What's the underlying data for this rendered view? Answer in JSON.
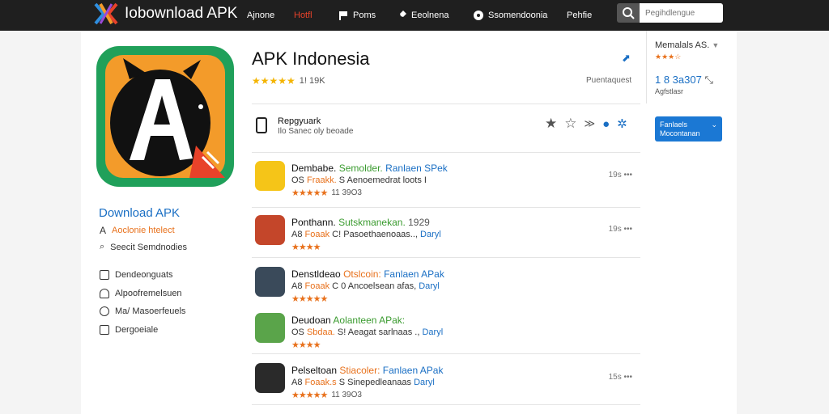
{
  "header": {
    "logo_text": "Iobownload APK",
    "nav": [
      {
        "label": "Ajnone",
        "icon": "none",
        "color": "#ffffff"
      },
      {
        "label": "Hotfl",
        "icon": "none",
        "color": "#e8422a"
      },
      {
        "label": "Poms",
        "icon": "flag-icon",
        "color": "#ffffff"
      },
      {
        "label": "Eeolnena",
        "icon": "puzzle-icon",
        "color": "#ffffff"
      },
      {
        "label": "Ssomendoonia",
        "icon": "chat-icon",
        "color": "#ffffff"
      },
      {
        "label": "Pehfie",
        "icon": "none",
        "color": "#ffffff"
      }
    ],
    "search_placeholder": "Pegihdlengue"
  },
  "app": {
    "title": "APK Indonesia",
    "rating_text": "1! 19K",
    "meta_right": "Puentaquest"
  },
  "developer": {
    "name": "Repgyuark",
    "sub": "Ilo Sanec oly beoade"
  },
  "left_panel": {
    "title": "Download APK",
    "row1": "Aoclonie htelect",
    "row2": "Seecit Semdnodies",
    "links": [
      "Dendeonguats",
      "Alpoofremelsuen",
      "Ma/ Masoerfeuels",
      "Dergoeiale"
    ]
  },
  "list": [
    {
      "name": "Dembabe.",
      "tag_green": "Semolder.",
      "tag_blue": "Ranlaen SPek",
      "prefix": "OS",
      "org_text": "Fraakk.",
      "desc": "S Aenoemedrat loots I",
      "blue_tail": "",
      "count": "11 39O3",
      "meta": "19s",
      "thumb": "#f5c518"
    },
    {
      "name": "Ponthann.",
      "tag_green": "Sutskmanekan.",
      "tag_blue": "1929",
      "prefix": "A8",
      "org_text": "Foaak",
      "desc": "C! Pasoethaenoaas..,",
      "blue_tail": "Daryl",
      "count": "",
      "meta": "19s",
      "thumb": "#c4462a"
    },
    {
      "name": "Denstldeao",
      "tag_green": "Otslcoin:",
      "tag_blue": "Fanlaen APak",
      "prefix": "A8",
      "org_text": "Foaak",
      "desc": "C 0 Ancoelsean afas,",
      "blue_tail": "Daryl",
      "count": "",
      "meta": "",
      "thumb": "#3a4a5a"
    },
    {
      "name": "Deudoan",
      "tag_green": "Aolanteen APak:",
      "tag_blue": "",
      "prefix": "OS",
      "org_text": "Sbdaa.",
      "desc": "S! Aeagat sarlnaas .,",
      "blue_tail": "Daryl",
      "count": "",
      "meta": "",
      "thumb": "#5aa44a"
    },
    {
      "name": "Pelseltoan",
      "tag_green": "Stiacoler:",
      "tag_blue": "Fanlaen APak",
      "prefix": "A8",
      "org_text": "Foaak.s",
      "desc": "S Sinepedleanaas",
      "blue_tail": "Daryl",
      "count": "11 39O3",
      "meta": "15s",
      "thumb": "#2a2a2a"
    }
  ],
  "sidebar": {
    "name": "Memalals AS.",
    "stars_text": "★★★☆",
    "number": "1 8 3a307",
    "sub": "Agfstlasr",
    "button_line1": "Fanlaels",
    "button_line2": "Mocontanan"
  },
  "colors": {
    "accent": "#1a6fc4",
    "topbar": "#1f1f1f",
    "star": "#f4b400",
    "star_orange": "#e8711c"
  }
}
